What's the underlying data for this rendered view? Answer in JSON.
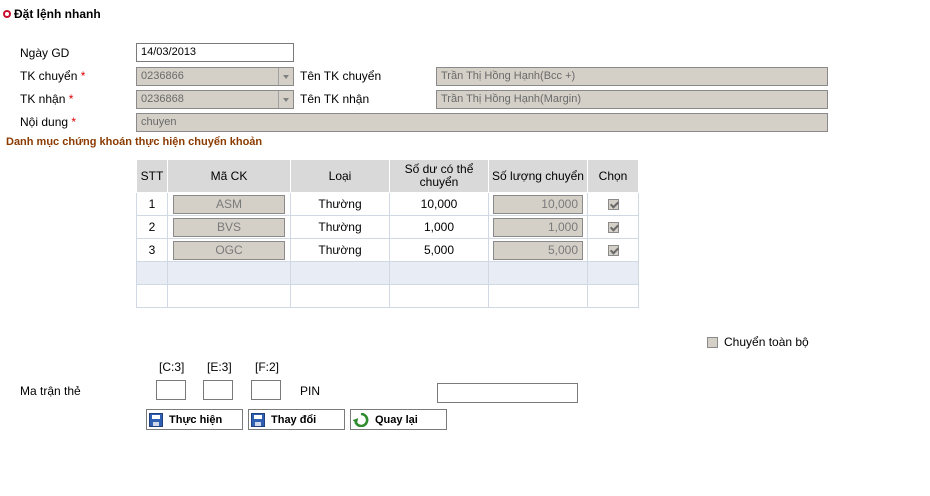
{
  "title": "Đặt lệnh nhanh",
  "form": {
    "ngay_gd_label": "Ngày GD",
    "ngay_gd_value": "14/03/2013",
    "tk_chuyen_label": "TK chuyển",
    "tk_chuyen_value": "0236866",
    "ten_tk_chuyen_label": "Tên TK chuyển",
    "ten_tk_chuyen_value": "Trần Thị Hồng Hạnh(Bcc +)",
    "tk_nhan_label": "TK nhận",
    "tk_nhan_value": "0236868",
    "ten_tk_nhan_label": "Tên TK nhận",
    "ten_tk_nhan_value": "Trần Thị Hồng Hạnh(Margin)",
    "noi_dung_label": "Nội dung",
    "noi_dung_value": "chuyen",
    "required_mark": "*"
  },
  "section_title": "Danh mục chứng khoán thực hiện chuyển khoản",
  "table": {
    "headers": [
      "STT",
      "Mã CK",
      "Loại",
      "Số dư có thể chuyển",
      "Số lượng chuyển",
      "Chọn"
    ],
    "rows": [
      {
        "stt": "1",
        "ma": "ASM",
        "loai": "Thường",
        "so_du": "10,000",
        "so_luong": "10,000",
        "chon": true
      },
      {
        "stt": "2",
        "ma": "BVS",
        "loai": "Thường",
        "so_du": "1,000",
        "so_luong": "1,000",
        "chon": true
      },
      {
        "stt": "3",
        "ma": "OGC",
        "loai": "Thường",
        "so_du": "5,000",
        "so_luong": "5,000",
        "chon": true
      }
    ]
  },
  "transfer_all_label": "Chuyển toàn bộ",
  "matrix": {
    "label": "Ma trận thẻ",
    "coords": [
      "[C:3]",
      "[E:3]",
      "[F:2]"
    ],
    "pin_label": "PIN"
  },
  "buttons": {
    "execute": "Thực hiện",
    "change": "Thay đổi",
    "back": "Quay lại"
  }
}
